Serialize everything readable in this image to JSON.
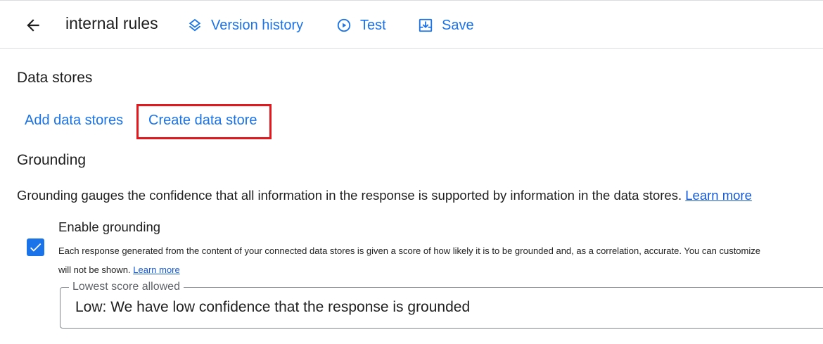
{
  "header": {
    "back_icon": "arrow-back-icon",
    "title": "internal rules",
    "actions": [
      {
        "label": "Version history",
        "icon": "layers-icon"
      },
      {
        "label": "Test",
        "icon": "play-circle-icon"
      },
      {
        "label": "Save",
        "icon": "save-download-icon"
      }
    ]
  },
  "data_stores": {
    "heading": "Data stores",
    "add_label": "Add data stores",
    "create_label": "Create data store",
    "highlight_color": "#e0191f"
  },
  "grounding": {
    "heading": "Grounding",
    "description": "Grounding gauges the confidence that all information in the response is supported by information in the data stores.",
    "learn_more": "Learn more",
    "enable_checkbox": {
      "checked": true,
      "label": "Enable grounding",
      "help_text": "Each response generated from the content of your connected data stores is given a score of how likely it is to be grounded and, as a correlation, accurate. You can customize",
      "help_text_continued": "will not be shown.",
      "help_learn_more": "Learn more"
    },
    "lowest_score": {
      "label": "Lowest score allowed",
      "value": "Low: We have low confidence that the response is grounded"
    }
  },
  "colors": {
    "accent": "#1a73e8",
    "link": "#1558d6",
    "text": "#1f1f1f",
    "border": "#dadce0"
  }
}
